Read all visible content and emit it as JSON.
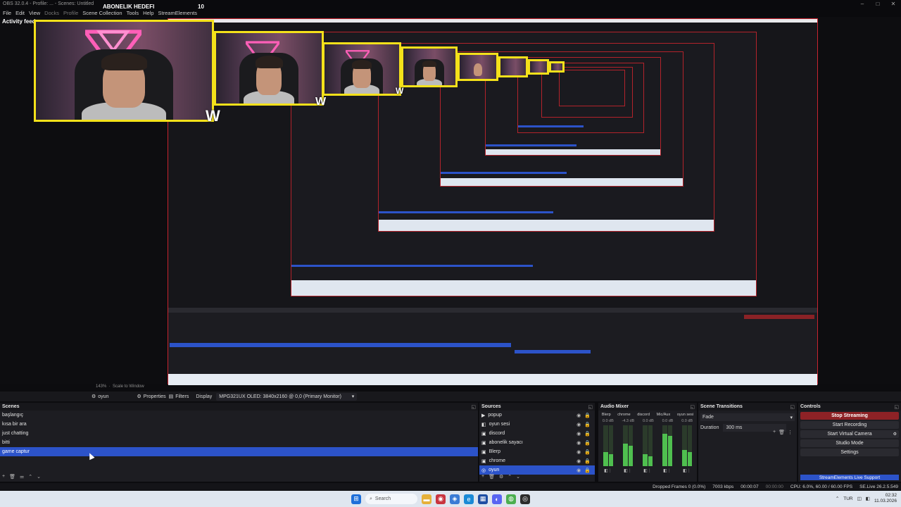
{
  "window": {
    "title": "OBS 32.0.4 - Profile: ... - Scenes: Untitled",
    "controls": [
      "–",
      "□",
      "✕"
    ]
  },
  "menu": [
    "File",
    "Edit",
    "View",
    "Docks",
    "Profile",
    "Scene Collection",
    "Tools",
    "Help",
    "StreamElements"
  ],
  "preview": {
    "activity_feed": "Activity feed",
    "overlay_title": "ABONELIK HEDEFI",
    "overlay_count": "10"
  },
  "subtoolbar": {
    "zoom": "143%",
    "scale": "Scale to Window"
  },
  "sourcebar": {
    "selected_source": "oyun",
    "properties": "Properties",
    "filters": "Filters",
    "display_label": "Display",
    "display_value": "MPG321UX OLED: 3840x2160 @ 0,0 (Primary Monitor)"
  },
  "scenes": {
    "title": "Scenes",
    "items": [
      {
        "label": "başlangıç",
        "selected": false
      },
      {
        "label": "kısa bir ara",
        "selected": false
      },
      {
        "label": "just chatting",
        "selected": false
      },
      {
        "label": "bitti",
        "selected": false
      },
      {
        "label": "game captur",
        "selected": true
      }
    ]
  },
  "sources": {
    "title": "Sources",
    "items": [
      {
        "label": "popup",
        "selected": false
      },
      {
        "label": "oyun sesi",
        "selected": false
      },
      {
        "label": "discord",
        "selected": false
      },
      {
        "label": "abonelik sayacı",
        "selected": false
      },
      {
        "label": "Blerp",
        "selected": false
      },
      {
        "label": "chrome",
        "selected": false
      },
      {
        "label": "oyun",
        "selected": true
      }
    ]
  },
  "mixer": {
    "title": "Audio Mixer",
    "channels": [
      {
        "name": "Blerp",
        "db": "0.0 dB",
        "level": 0.35
      },
      {
        "name": "chrome",
        "db": "-4.3 dB",
        "level": 0.55
      },
      {
        "name": "discord",
        "db": "0.0 dB",
        "level": 0.3
      },
      {
        "name": "Mic/Aux",
        "db": "0.0 dB",
        "level": 0.8
      },
      {
        "name": "oyun sesi",
        "db": "0.0 dB",
        "level": 0.4
      }
    ]
  },
  "transitions": {
    "title": "Scene Transitions",
    "type": "Fade",
    "duration_label": "Duration",
    "duration_value": "300 ms"
  },
  "controls": {
    "title": "Controls",
    "stop_streaming": "Stop Streaming",
    "start_recording": "Start Recording",
    "start_virtual_camera": "Start Virtual Camera",
    "studio_mode": "Studio Mode",
    "settings": "Settings",
    "support": "StreamElements Live Support"
  },
  "status": {
    "dropped": "Dropped Frames 0 (0.0%)",
    "bitrate": "7003 kbps",
    "stream_time": "00:00:07",
    "rec_time": "00:00:00",
    "cpu": "CPU: 6.0%, 60.00 / 60.00 FPS",
    "se": "SE.Live 26.2.5.549"
  },
  "taskbar": {
    "search": "Search",
    "lang": "TUR",
    "time": "02:32",
    "date": "11.03.2026"
  },
  "colors": {
    "accent": "#2c53c9",
    "stop": "#8e2226",
    "overlay_border": "#f4e11a"
  }
}
